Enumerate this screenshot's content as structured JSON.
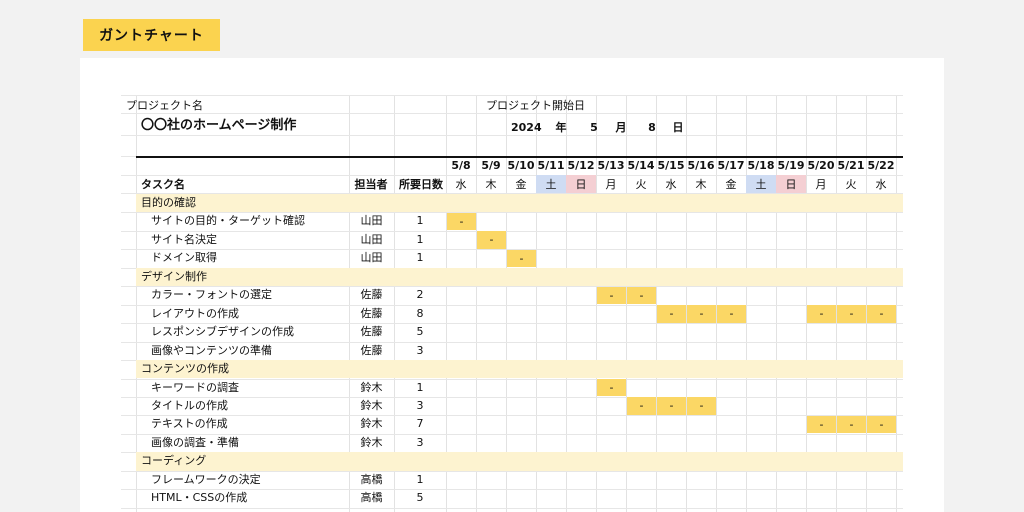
{
  "badge_title": "ガントチャート",
  "project": {
    "name_label": "プロジェクト名",
    "name": "〇〇社のホームページ制作",
    "start_label": "プロジェクト開始日",
    "year": "2024",
    "year_unit": "年",
    "month": "5",
    "month_unit": "月",
    "day": "8",
    "day_unit": "日"
  },
  "headers": {
    "task": "タスク名",
    "owner": "担当者",
    "days": "所要日数"
  },
  "dates": [
    {
      "date": "5/8",
      "dow": "水",
      "type": "weekday"
    },
    {
      "date": "5/9",
      "dow": "木",
      "type": "weekday"
    },
    {
      "date": "5/10",
      "dow": "金",
      "type": "weekday"
    },
    {
      "date": "5/11",
      "dow": "土",
      "type": "sat"
    },
    {
      "date": "5/12",
      "dow": "日",
      "type": "sun"
    },
    {
      "date": "5/13",
      "dow": "月",
      "type": "weekday"
    },
    {
      "date": "5/14",
      "dow": "火",
      "type": "weekday"
    },
    {
      "date": "5/15",
      "dow": "水",
      "type": "weekday"
    },
    {
      "date": "5/16",
      "dow": "木",
      "type": "weekday"
    },
    {
      "date": "5/17",
      "dow": "金",
      "type": "weekday"
    },
    {
      "date": "5/18",
      "dow": "土",
      "type": "sat"
    },
    {
      "date": "5/19",
      "dow": "日",
      "type": "sun"
    },
    {
      "date": "5/20",
      "dow": "月",
      "type": "weekday"
    },
    {
      "date": "5/21",
      "dow": "火",
      "type": "weekday"
    },
    {
      "date": "5/22",
      "dow": "水",
      "type": "weekday"
    }
  ],
  "bar_mark": "-",
  "rows": [
    {
      "type": "group",
      "name": "目的の確認"
    },
    {
      "type": "task",
      "name": "サイトの目的・ターゲット確認",
      "owner": "山田",
      "days": "1",
      "cells": [
        0
      ]
    },
    {
      "type": "task",
      "name": "サイト名決定",
      "owner": "山田",
      "days": "1",
      "cells": [
        1
      ]
    },
    {
      "type": "task",
      "name": "ドメイン取得",
      "owner": "山田",
      "days": "1",
      "cells": [
        2
      ]
    },
    {
      "type": "group",
      "name": "デザイン制作"
    },
    {
      "type": "task",
      "name": "カラー・フォントの選定",
      "owner": "佐藤",
      "days": "2",
      "cells": [
        5,
        6
      ]
    },
    {
      "type": "task",
      "name": "レイアウトの作成",
      "owner": "佐藤",
      "days": "8",
      "cells": [
        7,
        8,
        9,
        12,
        13,
        14
      ]
    },
    {
      "type": "task",
      "name": "レスポンシブデザインの作成",
      "owner": "佐藤",
      "days": "5",
      "cells": []
    },
    {
      "type": "task",
      "name": "画像やコンテンツの準備",
      "owner": "佐藤",
      "days": "3",
      "cells": []
    },
    {
      "type": "group",
      "name": "コンテンツの作成"
    },
    {
      "type": "task",
      "name": "キーワードの調査",
      "owner": "鈴木",
      "days": "1",
      "cells": [
        5
      ]
    },
    {
      "type": "task",
      "name": "タイトルの作成",
      "owner": "鈴木",
      "days": "3",
      "cells": [
        6,
        7,
        8
      ]
    },
    {
      "type": "task",
      "name": "テキストの作成",
      "owner": "鈴木",
      "days": "7",
      "cells": [
        12,
        13,
        14
      ]
    },
    {
      "type": "task",
      "name": "画像の調査・準備",
      "owner": "鈴木",
      "days": "3",
      "cells": []
    },
    {
      "type": "group",
      "name": "コーディング"
    },
    {
      "type": "task",
      "name": "フレームワークの決定",
      "owner": "高橋",
      "days": "1",
      "cells": []
    },
    {
      "type": "task",
      "name": "HTML・CSSの作成",
      "owner": "高橋",
      "days": "5",
      "cells": []
    }
  ]
}
